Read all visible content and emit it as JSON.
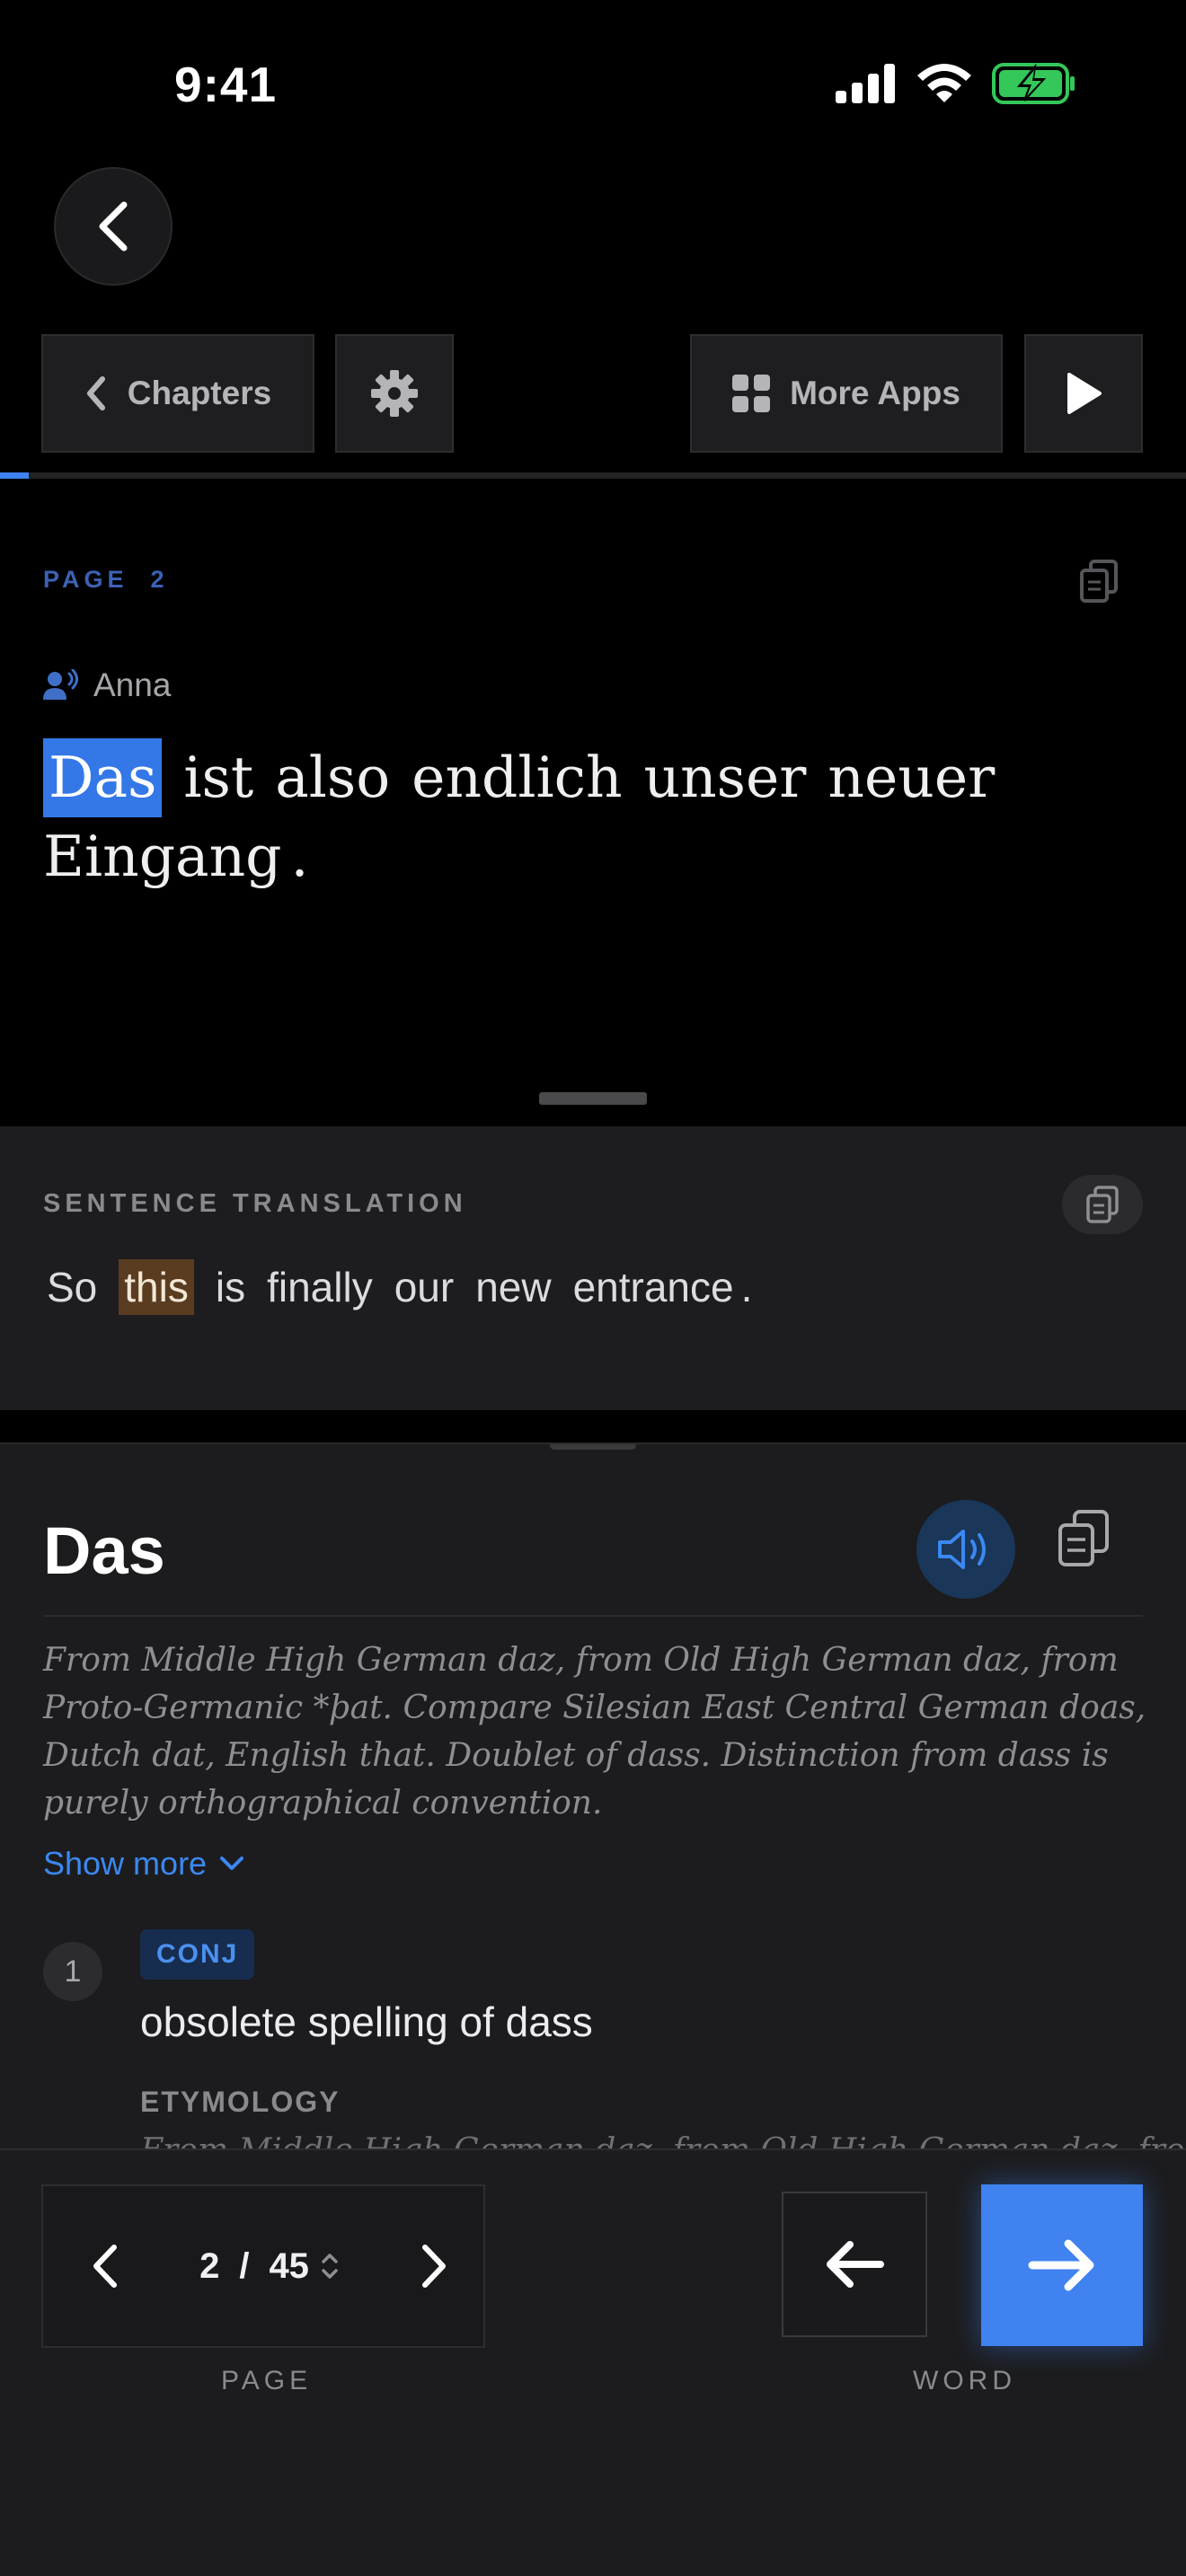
{
  "status_bar": {
    "time": "9:41"
  },
  "toolbar": {
    "chapters_label": "Chapters",
    "more_apps_label": "More Apps",
    "reading_progress": 0.024
  },
  "reader": {
    "page_label": "PAGE",
    "page_number": "2",
    "speaker": "Anna",
    "sentence_words": [
      "Das",
      "ist",
      "also",
      "endlich",
      "unser",
      "neuer",
      "Eingang",
      "."
    ],
    "highlighted_index": 0
  },
  "translation": {
    "label": "SENTENCE TRANSLATION",
    "words": [
      "So",
      "this",
      "is",
      "finally",
      "our",
      "new",
      "entrance",
      "."
    ],
    "highlighted_index": 1
  },
  "word": {
    "title": "Das",
    "etymology_summary": "From Middle High German daz, from Old High German daz, from Proto-Germanic *þat. Compare Silesian East Central German doas, Dutch dat, English that. Doublet of dass. Distinction from dass is purely orthographical convention.",
    "show_more": "Show more",
    "definitions": [
      {
        "number": "1",
        "pos": "CONJ",
        "text": "obsolete spelling of dass",
        "etymology_label": "ETYMOLOGY",
        "etymology_preview": "From Middle High German daz, from Old High German daz, from"
      }
    ]
  },
  "bottom_nav": {
    "current_page": "2",
    "separator": "/",
    "total_pages": "45",
    "page_caption": "PAGE",
    "word_caption": "WORD"
  },
  "colors": {
    "accent": "#3f82f0",
    "word_highlight": "#3478e8",
    "translation_highlight": "#5a3c20",
    "battery_green": "#34c759"
  }
}
